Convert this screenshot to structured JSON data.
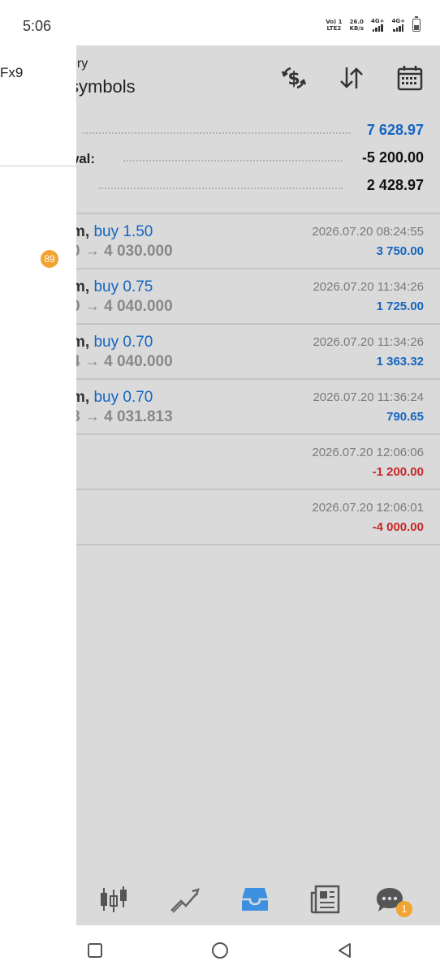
{
  "status_bar": {
    "time": "5:06",
    "volte_top": "Vo) 1",
    "volte_bottom": "LTE2",
    "speed_top": "26.0",
    "speed_bottom": "KB/s",
    "sim1_label": "4G+",
    "sim2_label": "4G+"
  },
  "drawer": {
    "account_fragment": "Fx9",
    "badge_count": "89"
  },
  "header": {
    "subtitle_fragment": "ory",
    "title_fragment": "symbols",
    "icons": [
      "currency-exchange-icon",
      "sort-icon",
      "calendar-icon"
    ]
  },
  "summary": {
    "row1_value": "7 628.97",
    "row2_label": "wal:",
    "row2_value": "-5 200.00",
    "row3_value": "2 428.97",
    "value_color_profit": "#1565c0"
  },
  "deals": [
    {
      "symbol_fragment": "m,",
      "side": "buy 1.50",
      "prices": "0 → 4 030.000",
      "time": "2026.07.20 08:24:55",
      "profit": "3 750.00"
    },
    {
      "symbol_fragment": "m,",
      "side": "buy 0.75",
      "prices": "0 → 4 040.000",
      "time": "2026.07.20 11:34:26",
      "profit": "1 725.00"
    },
    {
      "symbol_fragment": "m,",
      "side": "buy 0.70",
      "prices": "4 → 4 040.000",
      "time": "2026.07.20 11:34:26",
      "profit": "1 363.32"
    },
    {
      "symbol_fragment": "m,",
      "side": "buy 0.70",
      "prices": "8 → 4 031.813",
      "time": "2026.07.20 11:36:24",
      "profit": "790.65"
    }
  ],
  "balance_ops": [
    {
      "time": "2026.07.20 12:06:06",
      "amount": "-1 200.00"
    },
    {
      "time": "2026.07.20 12:06:01",
      "amount": "-4 000.00"
    }
  ],
  "colors": {
    "positive": "#1565c0",
    "negative": "#c62828",
    "badge": "#f2a431",
    "active_tab": "#3d8fe0"
  },
  "bottom_nav": {
    "items": [
      "quotes-icon",
      "chart-icon",
      "history-icon",
      "news-icon",
      "chat-icon"
    ],
    "active": "history-icon",
    "chat_badge": "1"
  }
}
